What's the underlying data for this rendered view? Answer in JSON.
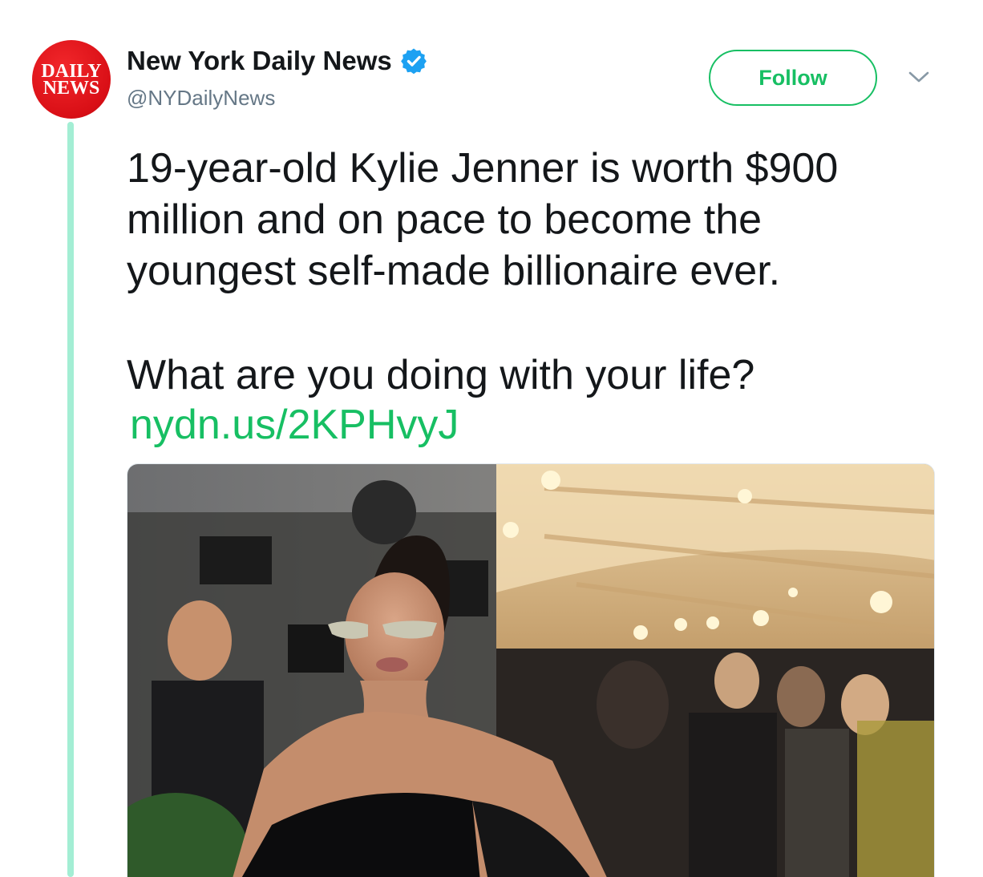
{
  "account": {
    "display_name": "New York Daily News",
    "handle": "@NYDailyNews",
    "avatar_text": [
      "DAILY",
      "NEWS"
    ],
    "verified": true
  },
  "actions": {
    "follow_label": "Follow"
  },
  "tweet": {
    "paragraphs": [
      "19-year-old Kylie Jenner is worth $900 million and on pace to become the youngest self-made billionaire ever.",
      "What are you doing with your life?"
    ],
    "link_text": "nydn.us/2KPHvyJ"
  },
  "colors": {
    "accent": "#17bf63",
    "thread_line": "#a3eed4",
    "verified_blue": "#1da1f2",
    "avatar_red": "#d90f16",
    "text_primary": "#14171a",
    "text_secondary": "#657786"
  },
  "icons": {
    "verified": "verified-badge-icon",
    "caret": "chevron-down-icon"
  }
}
